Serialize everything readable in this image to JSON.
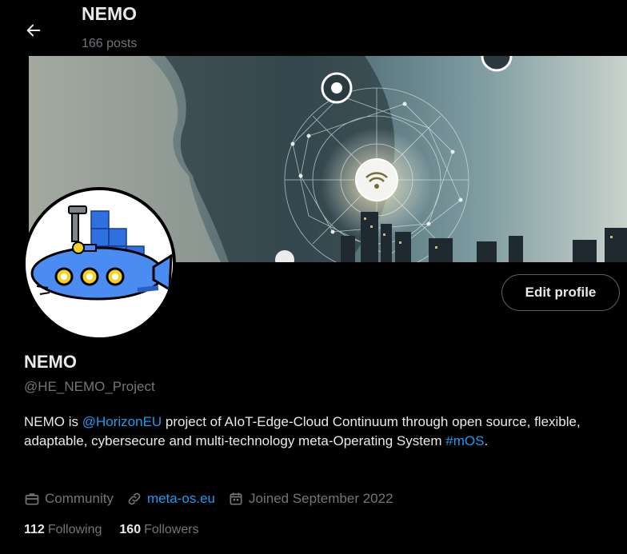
{
  "header": {
    "title": "NEMO",
    "subtitle": "166 posts"
  },
  "profile": {
    "name": "NEMO",
    "handle": "@HE_NEMO_Project",
    "edit_label": "Edit profile",
    "bio": {
      "part1": "NEMO is ",
      "mention": "@HorizonEU",
      "part2": " project of AIoT-Edge-Cloud Continuum through open source, flexible, adaptable, cybersecure and multi-technology meta-Operating System ",
      "hashtag": "#mOS",
      "part3": "."
    },
    "meta": {
      "category": "Community",
      "website": "meta-os.eu",
      "joined": "Joined September 2022"
    },
    "stats": {
      "following_count": "112",
      "following_label": "Following",
      "followers_count": "160",
      "followers_label": "Followers"
    }
  },
  "colors": {
    "accent": "#1d9bf0",
    "muted": "#71767b",
    "text": "#e7e9ea"
  }
}
